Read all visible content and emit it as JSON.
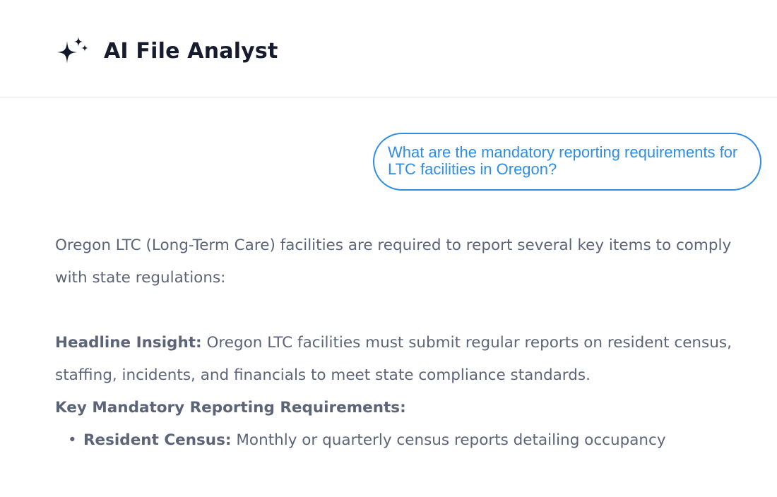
{
  "app": {
    "title": "AI File Analyst",
    "logo_icon": "sparkles-icon"
  },
  "chat": {
    "user_question": "What are the mandatory reporting requirements for LTC facilities in Oregon?",
    "response": {
      "intro": "Oregon LTC (Long-Term Care) facilities are required to report several key items to comply with state regulations:",
      "headline_label": "Headline Insight:",
      "headline_text": "Oregon LTC facilities must submit regular reports on resident census, staffing, incidents, and financials to meet state compliance standards.",
      "section_heading": "Key Mandatory Reporting Requirements:",
      "requirements": [
        {
          "label": "Resident Census:",
          "text": "Monthly or quarterly census reports detailing occupancy"
        }
      ]
    }
  },
  "colors": {
    "accent": "#2f8de4",
    "title_text": "#161b2e",
    "body_text": "#5c6478",
    "divider": "#e6e8ec"
  }
}
